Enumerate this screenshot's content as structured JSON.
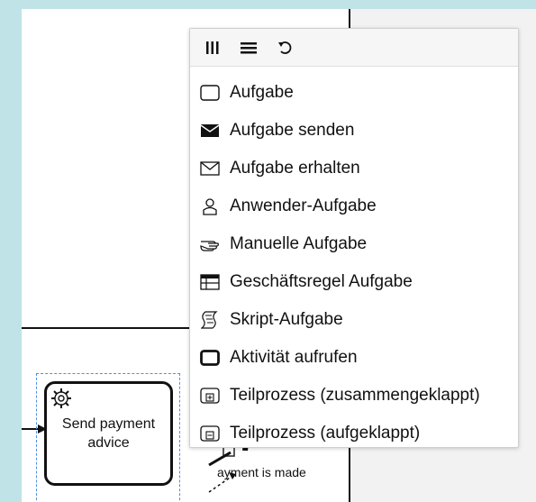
{
  "task": {
    "label": "Send payment advice"
  },
  "event_label": "Payment is made",
  "event_label_visible": "ayment is made",
  "popup": {
    "header_icons": [
      "column-toggle-icon",
      "list-view-icon",
      "reset-icon"
    ],
    "entries": [
      {
        "label": "Aufgabe",
        "icon": "task-icon"
      },
      {
        "label": "Aufgabe senden",
        "icon": "send-envelope-filled-icon"
      },
      {
        "label": "Aufgabe erhalten",
        "icon": "receive-envelope-icon"
      },
      {
        "label": "Anwender-Aufgabe",
        "icon": "user-icon"
      },
      {
        "label": "Manuelle Aufgabe",
        "icon": "hand-icon"
      },
      {
        "label": "Geschäftsregel Aufgabe",
        "icon": "business-rule-table-icon"
      },
      {
        "label": "Skript-Aufgabe",
        "icon": "script-icon"
      },
      {
        "label": "Aktivität aufrufen",
        "icon": "call-activity-icon"
      },
      {
        "label": "Teilprozess (zusammengeklappt)",
        "icon": "subprocess-collapsed-icon"
      },
      {
        "label": "Teilprozess (aufgeklappt)",
        "icon": "subprocess-expanded-icon"
      }
    ]
  }
}
